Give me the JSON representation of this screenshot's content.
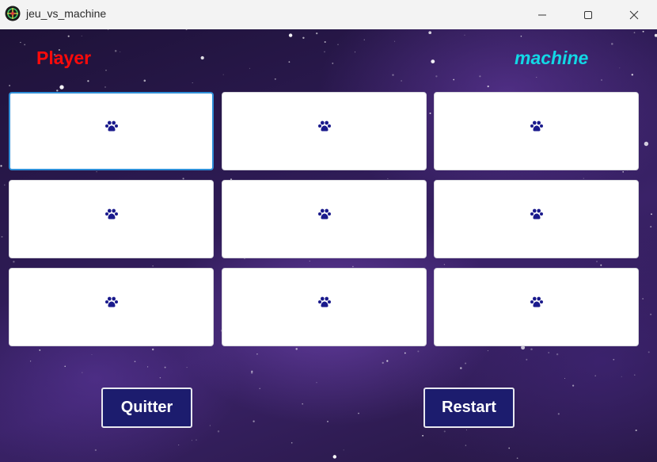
{
  "window": {
    "title": "jeu_vs_machine",
    "icon": "game-logo-icon",
    "controls": [
      "minimize-icon",
      "maximize-icon",
      "close-icon"
    ]
  },
  "labels": {
    "player": "Player",
    "machine": "machine"
  },
  "board": {
    "cell_icon": "paw-icon",
    "cells": [
      {
        "row": 1,
        "col": 1,
        "focused": true
      },
      {
        "row": 1,
        "col": 2,
        "focused": false
      },
      {
        "row": 1,
        "col": 3,
        "focused": false
      },
      {
        "row": 2,
        "col": 1,
        "focused": false
      },
      {
        "row": 2,
        "col": 2,
        "focused": false
      },
      {
        "row": 2,
        "col": 3,
        "focused": false
      },
      {
        "row": 3,
        "col": 1,
        "focused": false
      },
      {
        "row": 3,
        "col": 2,
        "focused": false
      },
      {
        "row": 3,
        "col": 3,
        "focused": false
      }
    ]
  },
  "buttons": {
    "quit": "Quitter",
    "restart": "Restart"
  },
  "colors": {
    "player": "#ff0a0a",
    "machine": "#12d8e6",
    "button_bg": "#1c1c6e",
    "cell_icon": "#1a1a8c",
    "focus_border": "#2f8fd8"
  }
}
